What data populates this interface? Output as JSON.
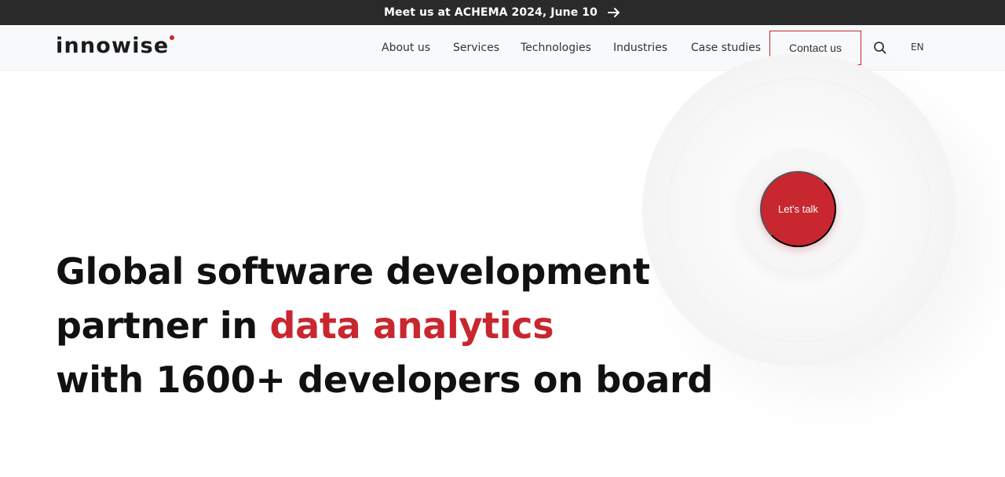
{
  "announcement": {
    "text": "Meet us at ACHEMA 2024, June 10",
    "icon": "arrow-right-icon"
  },
  "brand": {
    "logo_text": "innowise",
    "accent_color": "#c8272f"
  },
  "nav": {
    "items": [
      {
        "label": "About us"
      },
      {
        "label": "Services"
      },
      {
        "label": "Technologies"
      },
      {
        "label": "Industries"
      },
      {
        "label": "Case studies"
      }
    ],
    "contact_label": "Contact us",
    "search_icon": "search-icon",
    "language": "EN"
  },
  "cta": {
    "talk_label": "Let's talk"
  },
  "hero": {
    "line1": "Global software development",
    "line2_prefix": "partner in ",
    "line2_highlight": "data analytics",
    "line3": "with 1600+ developers on board"
  }
}
